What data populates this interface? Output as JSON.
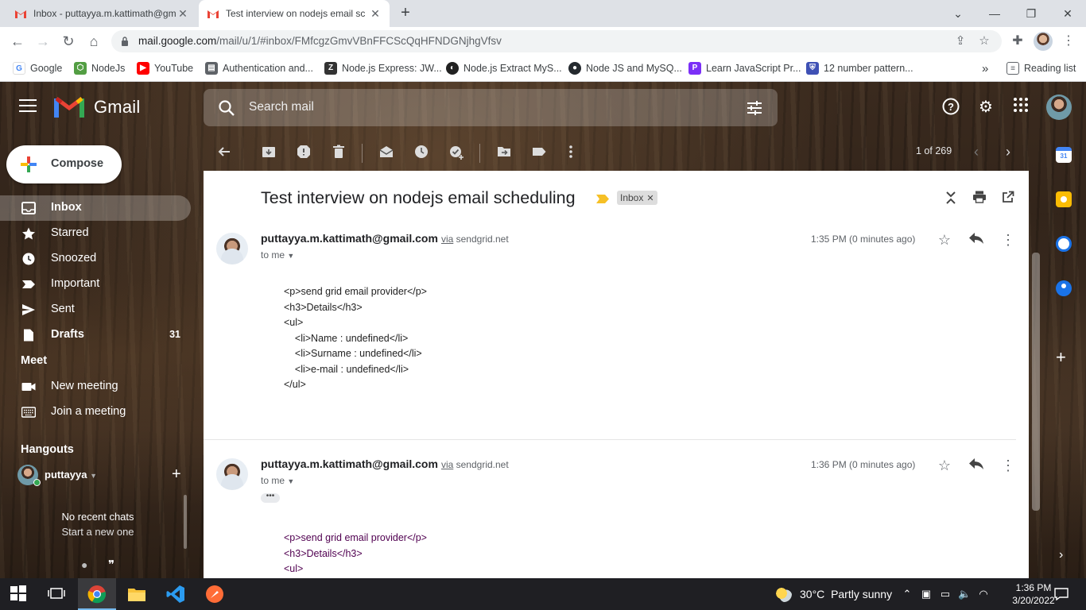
{
  "browser": {
    "tabs": [
      {
        "title": "Inbox - puttayya.m.kattimath@gm",
        "active": false
      },
      {
        "title": "Test interview on nodejs email sc",
        "active": true
      }
    ],
    "url_host": "mail.google.com",
    "url_path": "/mail/u/1/#inbox/FMfcgzGmvVBnFFCScQqHFNDGNjhgVfsv",
    "bookmarks": [
      {
        "label": "Google",
        "icon": "google-icon"
      },
      {
        "label": "NodeJs",
        "icon": "nodejs-icon"
      },
      {
        "label": "YouTube",
        "icon": "youtube-icon"
      },
      {
        "label": "Authentication and...",
        "icon": "page-icon"
      },
      {
        "label": "Node.js Express: JW...",
        "icon": "z-icon"
      },
      {
        "label": "Node.js Extract MyS...",
        "icon": "circle-icon"
      },
      {
        "label": "Node JS and MySQ...",
        "icon": "github-icon"
      },
      {
        "label": "Learn JavaScript Pr...",
        "icon": "p-icon"
      },
      {
        "label": "12 number pattern...",
        "icon": "shield-icon"
      }
    ],
    "bookmarks_more": "»",
    "reading_list": "Reading list"
  },
  "gmail": {
    "logo_text": "Gmail",
    "search_placeholder": "Search mail",
    "compose_label": "Compose",
    "nav": [
      {
        "label": "Inbox",
        "icon": "inbox-icon",
        "active": true,
        "count": ""
      },
      {
        "label": "Starred",
        "icon": "star-icon",
        "active": false,
        "count": ""
      },
      {
        "label": "Snoozed",
        "icon": "clock-icon",
        "active": false,
        "count": ""
      },
      {
        "label": "Important",
        "icon": "important-icon",
        "active": false,
        "count": ""
      },
      {
        "label": "Sent",
        "icon": "send-icon",
        "active": false,
        "count": ""
      },
      {
        "label": "Drafts",
        "icon": "draft-icon",
        "active": false,
        "count": "31"
      }
    ],
    "meet_section": "Meet",
    "meet_items": [
      "New meeting",
      "Join a meeting"
    ],
    "hangouts_section": "Hangouts",
    "hangouts_user": "puttayya",
    "no_chats": "No recent chats",
    "start_new": "Start a new one",
    "pager": "1 of 269",
    "thread": {
      "subject": "Test interview on nodejs email scheduling",
      "label_chip": "Inbox",
      "messages": [
        {
          "from": "puttayya.m.kattimath@gmail.com",
          "via_word": "via",
          "via_domain": "sendgrid.net",
          "to": "to me",
          "time": "1:35 PM (0 minutes ago)",
          "body": [
            "<p>send grid email provider</p>",
            "<h3>Details</h3>",
            "<ul>",
            "    <li>Name : undefined</li>",
            "    <li>Surname : undefined</li>",
            "    <li>e-mail : undefined</li>",
            "</ul>"
          ]
        },
        {
          "from": "puttayya.m.kattimath@gmail.com",
          "via_word": "via",
          "via_domain": "sendgrid.net",
          "to": "to me",
          "time": "1:36 PM (0 minutes ago)",
          "body": [
            "<p>send grid email provider</p>",
            "<h3>Details</h3>",
            "<ul>"
          ]
        }
      ]
    }
  },
  "taskbar": {
    "weather_temp": "30°C",
    "weather_text": "Partly sunny",
    "time": "1:36 PM",
    "date": "3/20/2022"
  },
  "colors": {
    "gmail_red": "#ea4335",
    "accent_blue": "#1a73e8",
    "wood_dark": "#2f2219",
    "purple_quote": "#500050"
  }
}
